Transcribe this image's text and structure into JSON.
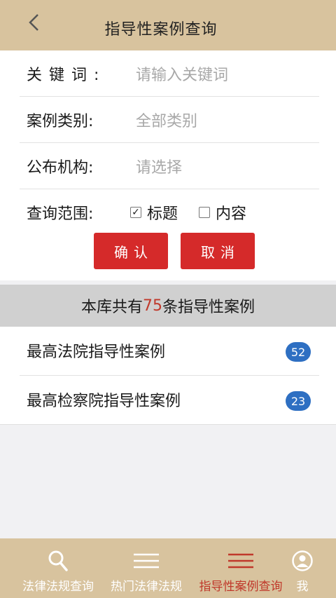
{
  "header": {
    "title": "指导性案例查询",
    "back_glyph": "<"
  },
  "form": {
    "keyword": {
      "label": "关键词:",
      "placeholder": "请输入关键词"
    },
    "category": {
      "label": "案例类别:",
      "placeholder": "全部类别"
    },
    "publisher": {
      "label": "公布机构:",
      "placeholder": "请选择"
    },
    "scope": {
      "label": "查询范围:",
      "options": [
        {
          "label": "标题",
          "checked": true
        },
        {
          "label": "内容",
          "checked": false
        }
      ]
    },
    "confirm_label": "确认",
    "cancel_label": "取消",
    "button_color": "#d52a2a"
  },
  "summary": {
    "prefix": "本库共有",
    "count": "75",
    "suffix": "条指导性案例",
    "count_color": "#c0392b"
  },
  "list": {
    "items": [
      {
        "title": "最高法院指导性案例",
        "count": "52"
      },
      {
        "title": "最高检察院指导性案例",
        "count": "23"
      }
    ],
    "badge_color": "#2e6fc2"
  },
  "tabbar": {
    "background": "#d8c39e",
    "active_color": "#c0392b",
    "tabs": [
      {
        "label": "法律法规查询",
        "icon": "search-icon",
        "active": false
      },
      {
        "label": "热门法律法规",
        "icon": "menu-icon",
        "active": false
      },
      {
        "label": "指导性案例查询",
        "icon": "menu-icon",
        "active": true
      },
      {
        "label": "我",
        "icon": "user-icon",
        "active": false
      }
    ]
  }
}
